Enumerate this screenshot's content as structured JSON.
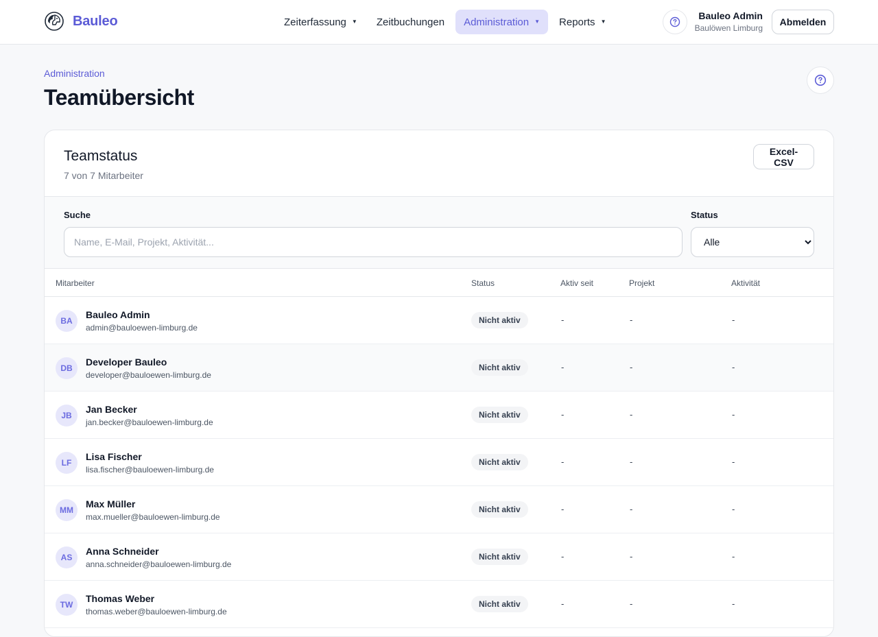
{
  "brand": {
    "name": "Bauleo"
  },
  "nav": [
    {
      "label": "Zeiterfassung",
      "dropdown": true,
      "active": false
    },
    {
      "label": "Zeitbuchungen",
      "dropdown": false,
      "active": false
    },
    {
      "label": "Administration",
      "dropdown": true,
      "active": true
    },
    {
      "label": "Reports",
      "dropdown": true,
      "active": false
    }
  ],
  "user": {
    "name": "Bauleo Admin",
    "org": "Baulöwen Limburg",
    "logout_label": "Abmelden"
  },
  "page": {
    "breadcrumb": "Administration",
    "title": "Teamübersicht"
  },
  "card": {
    "title": "Teamstatus",
    "subtitle": "7 von 7 Mitarbeiter",
    "export_label": "Excel-CSV",
    "filters": {
      "search_label": "Suche",
      "search_placeholder": "Name, E-Mail, Projekt, Aktivität...",
      "status_label": "Status",
      "status_value": "Alle"
    },
    "columns": [
      "Mitarbeiter",
      "Status",
      "Aktiv seit",
      "Projekt",
      "Aktivität"
    ],
    "rows": [
      {
        "initials": "BA",
        "name": "Bauleo Admin",
        "email": "admin@bauloewen-limburg.de",
        "status": "Nicht aktiv",
        "since": "-",
        "project": "-",
        "activity": "-"
      },
      {
        "initials": "DB",
        "name": "Developer Bauleo",
        "email": "developer@bauloewen-limburg.de",
        "status": "Nicht aktiv",
        "since": "-",
        "project": "-",
        "activity": "-"
      },
      {
        "initials": "JB",
        "name": "Jan Becker",
        "email": "jan.becker@bauloewen-limburg.de",
        "status": "Nicht aktiv",
        "since": "-",
        "project": "-",
        "activity": "-"
      },
      {
        "initials": "LF",
        "name": "Lisa Fischer",
        "email": "lisa.fischer@bauloewen-limburg.de",
        "status": "Nicht aktiv",
        "since": "-",
        "project": "-",
        "activity": "-"
      },
      {
        "initials": "MM",
        "name": "Max Müller",
        "email": "max.mueller@bauloewen-limburg.de",
        "status": "Nicht aktiv",
        "since": "-",
        "project": "-",
        "activity": "-"
      },
      {
        "initials": "AS",
        "name": "Anna Schneider",
        "email": "anna.schneider@bauloewen-limburg.de",
        "status": "Nicht aktiv",
        "since": "-",
        "project": "-",
        "activity": "-"
      },
      {
        "initials": "TW",
        "name": "Thomas Weber",
        "email": "thomas.weber@bauloewen-limburg.de",
        "status": "Nicht aktiv",
        "since": "-",
        "project": "-",
        "activity": "-"
      }
    ]
  },
  "colors": {
    "accent": "#5b5bd6",
    "accent_bg": "#e0e0fb"
  },
  "icons": {
    "logo": "lion-logo-icon",
    "help": "question-circle-icon",
    "caret": "caret-down-icon"
  }
}
